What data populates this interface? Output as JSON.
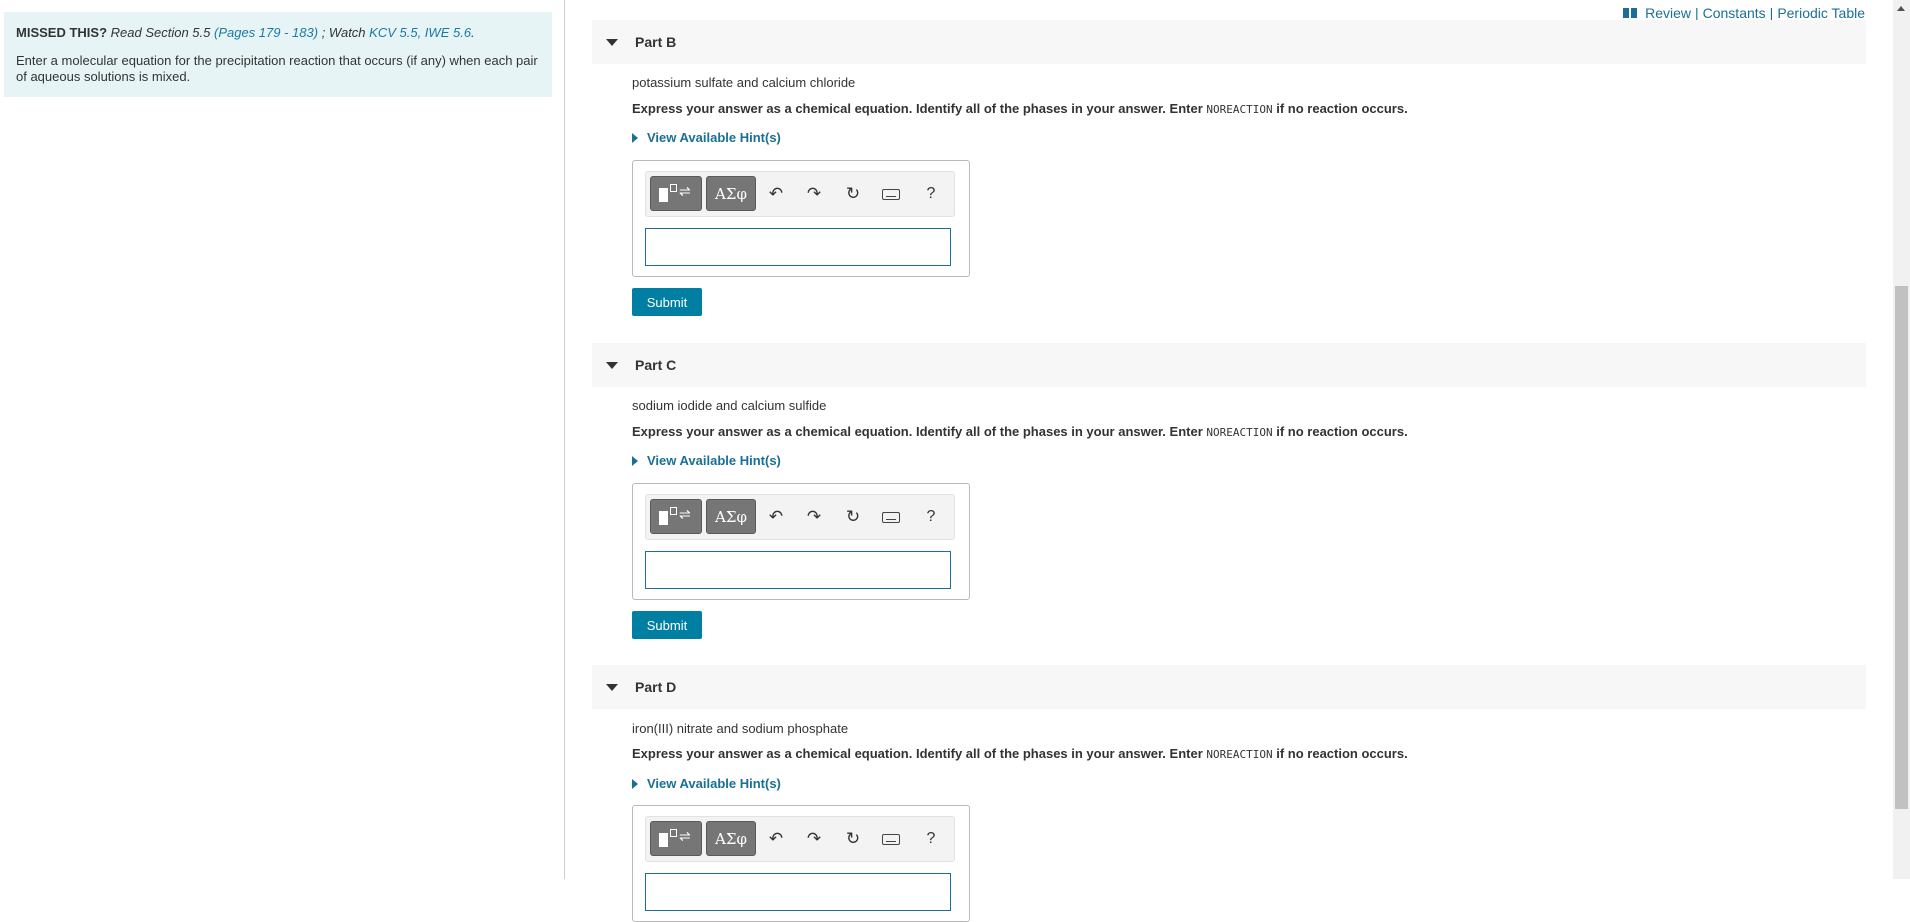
{
  "top_links": {
    "review": "Review",
    "constants": "Constants",
    "periodic_table": "Periodic Table",
    "separator": "|"
  },
  "intro": {
    "missed": "MISSED THIS?",
    "read_section": "Read Section 5.5",
    "pages_link": "(Pages 179 - 183)",
    "watch": "; Watch",
    "kcv_link": "KCV 5.5, IWE 5.6",
    "period": ".",
    "instruction": "Enter a molecular equation for the precipitation reaction that occurs (if any) when each pair of aqueous solutions is mixed."
  },
  "express_prefix": "Express your answer as a chemical equation. Identify all of the phases in your answer. Enter",
  "express_keyword": "NOREACTION",
  "express_suffix": "if no reaction occurs.",
  "hint_label": "View Available Hint(s)",
  "submit_label": "Submit",
  "toolbar": {
    "greek_label": "ΑΣφ",
    "help_label": "?",
    "equilibrium_symbol": "⇌"
  },
  "parts": [
    {
      "title": "Part B",
      "reactants": "potassium sulfate and calcium chloride"
    },
    {
      "title": "Part C",
      "reactants": "sodium iodide and calcium sulfide"
    },
    {
      "title": "Part D",
      "reactants": "iron(III) nitrate and sodium phosphate"
    }
  ],
  "icons": [
    "book-icon",
    "caret-down-icon",
    "triangle-right-icon",
    "templates-icon",
    "undo-icon",
    "redo-icon",
    "reset-icon",
    "keyboard-icon",
    "help-icon"
  ]
}
